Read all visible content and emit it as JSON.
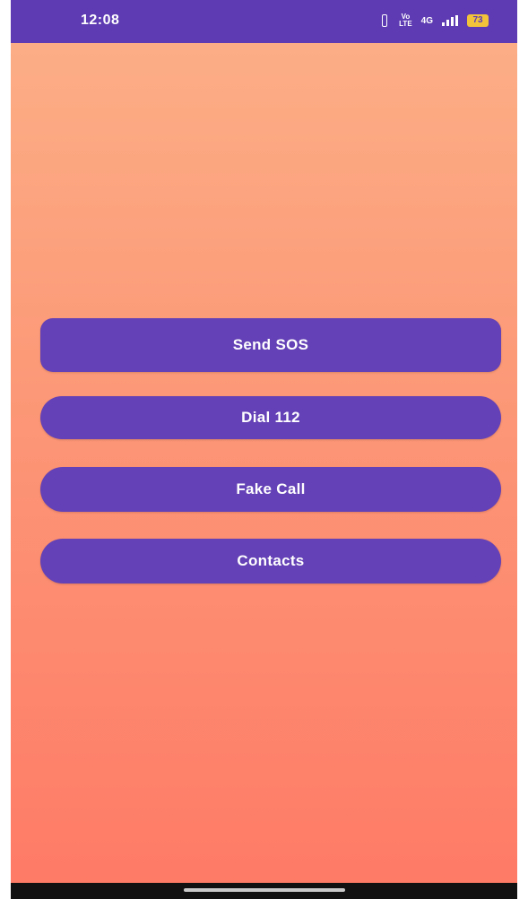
{
  "status_bar": {
    "time": "12:08",
    "volte_top": "Vo",
    "volte_bottom": "LTE",
    "network": "4G",
    "battery": "73"
  },
  "buttons": {
    "send_sos": "Send SOS",
    "dial": "Dial 112",
    "fake_call": "Fake Call",
    "contacts": "Contacts"
  },
  "colors": {
    "status_bar": "#5e3bb2",
    "button": "#6441b6",
    "background_top": "#fcb087",
    "background_bottom": "#fe7a66",
    "battery": "#f2c33a"
  },
  "icons": [
    "vibrate-icon",
    "volte-icon",
    "network-4g-icon",
    "signal-icon",
    "battery-icon"
  ]
}
